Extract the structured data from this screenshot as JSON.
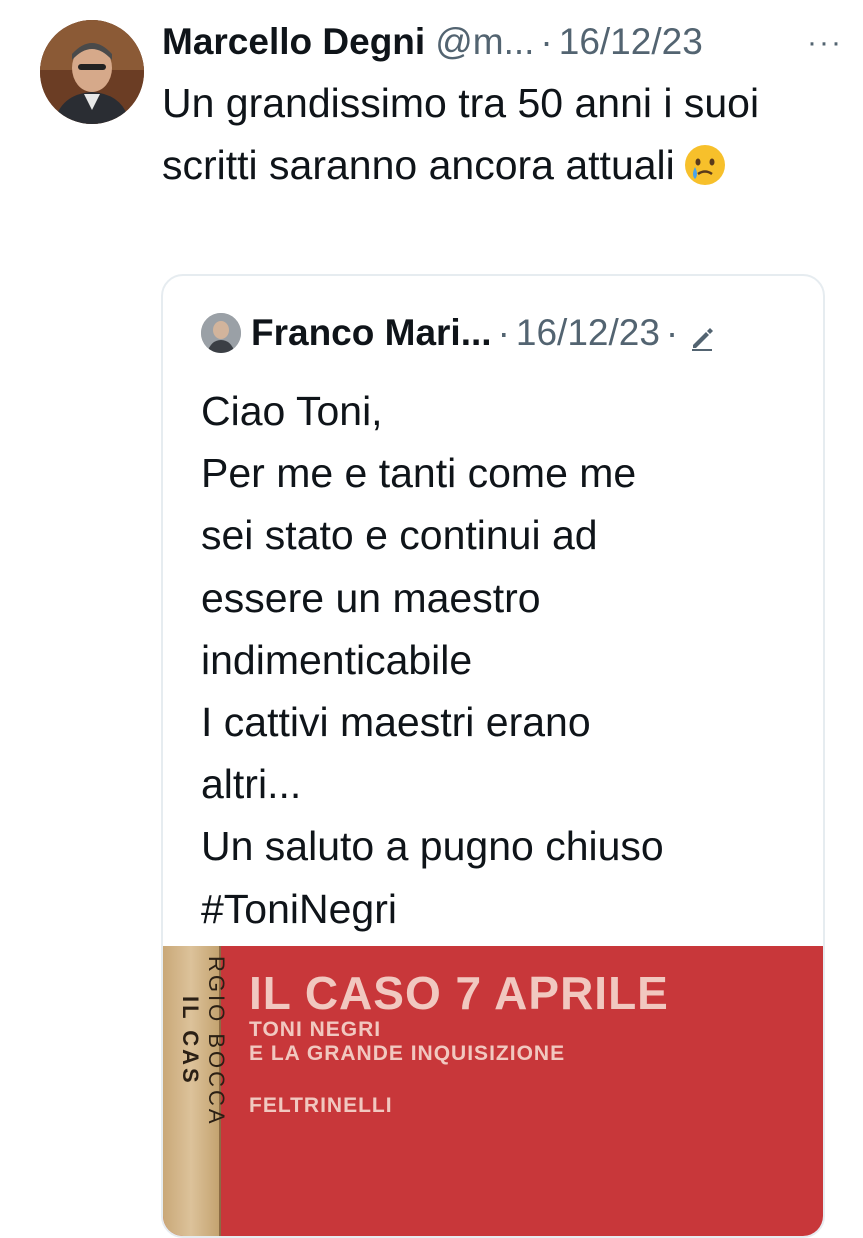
{
  "tweet": {
    "author_name": "Marcello Degni",
    "author_handle": "@m...",
    "separator": "·",
    "date": "16/12/23",
    "more_label": "···",
    "text": "Un grandissimo tra 50 anni i suoi scritti saranno ancora attuali"
  },
  "quoted_tweet": {
    "author_name": "Franco Mari...",
    "separator": "·",
    "date": "16/12/23",
    "separator2": "·",
    "text": "Ciao Toni,\nPer me e tanti come me\nsei stato e continui ad\nessere un maestro\nindimenticabile\nI cattivi maestri erano\naltri...\nUn saluto a pugno chiuso\n#ToniNegri",
    "image": {
      "title": "IL CASO 7 APRILE",
      "subtitle_line1": "TONI NEGRI",
      "subtitle_line2": "E LA GRANDE INQUISIZIONE",
      "publisher": "FELTRINELLI",
      "spine_author": "RGIO BOCCA",
      "spine_title": "IL CAS"
    }
  },
  "colors": {
    "text": "#0f1419",
    "secondary": "#536471",
    "border": "#e6ecf0",
    "book_red": "#c8373a"
  },
  "icons": [
    "avatar",
    "more-icon",
    "crying-face-emoji",
    "edit-pencil-icon"
  ]
}
